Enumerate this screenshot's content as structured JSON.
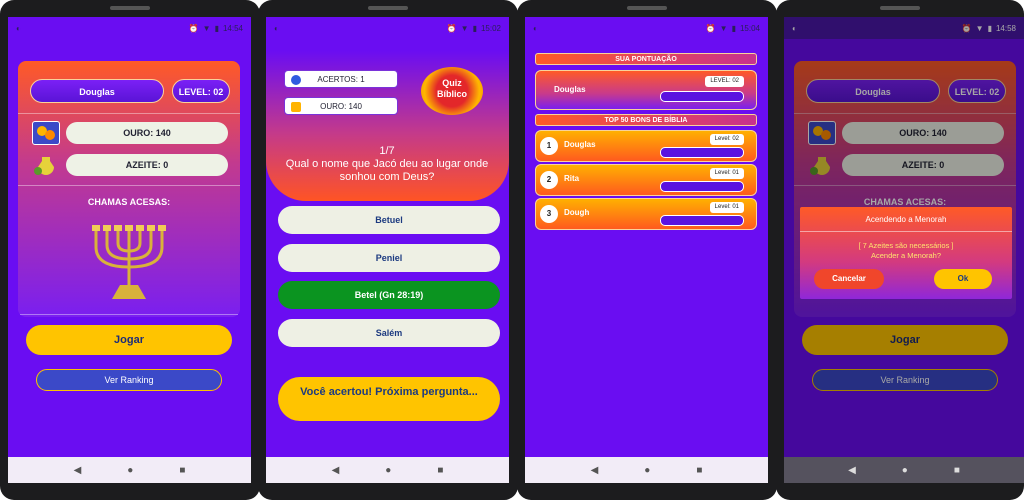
{
  "screens": [
    {
      "status_time": "14:54",
      "user_name": "Douglas",
      "level": "LEVEL: 02",
      "gold": "OURO: 140",
      "oil": "AZEITE: 0",
      "flames_label": "CHAMAS ACESAS:",
      "play_button": "Jogar",
      "ranking_button": "Ver Ranking"
    },
    {
      "status_time": "15:02",
      "hits": "ACERTOS: 1",
      "gold": "OURO: 140",
      "logo_line1": "Quiz",
      "logo_line2": "Bíblico",
      "progress": "1/7",
      "question": "Qual o nome que Jacó deu ao lugar onde sonhou com Deus?",
      "answers": [
        "Betuel",
        "Peniel",
        "Betel (Gn 28:19)",
        "Salém"
      ],
      "next_button": "Você acertou! Próxima pergunta..."
    },
    {
      "status_time": "15:04",
      "your_score_title": "SUA PONTUAÇÃO",
      "my_name": "Douglas",
      "my_level": "LEVEL: 02",
      "top_title": "TOP 50 BONS DE BÍBLIA",
      "ranking": [
        {
          "pos": "1",
          "name": "Douglas",
          "level": "Level: 02"
        },
        {
          "pos": "2",
          "name": "Rita",
          "level": "Level: 01"
        },
        {
          "pos": "3",
          "name": "Dough",
          "level": "Level: 01"
        }
      ]
    },
    {
      "status_time": "14:58",
      "user_name": "Douglas",
      "level": "LEVEL: 02",
      "gold": "OURO: 140",
      "oil": "AZEITE: 0",
      "flames_label": "CHAMAS ACESAS:",
      "play_button": "Jogar",
      "ranking_button": "Ver Ranking",
      "dialog": {
        "title": "Acendendo a Menorah",
        "message_line1": "[ 7 Azeites são necessários ]",
        "message_line2": "Acender a Menorah?",
        "cancel": "Cancelar",
        "ok": "Ok"
      }
    }
  ],
  "nav_icons": [
    "back-icon",
    "home-icon",
    "recents-icon"
  ],
  "colors": {
    "background_purple": "#6a0df2",
    "accent_orange": "#ff5a26",
    "accent_yellow": "#ffc400",
    "correct_green": "#0b9420"
  }
}
